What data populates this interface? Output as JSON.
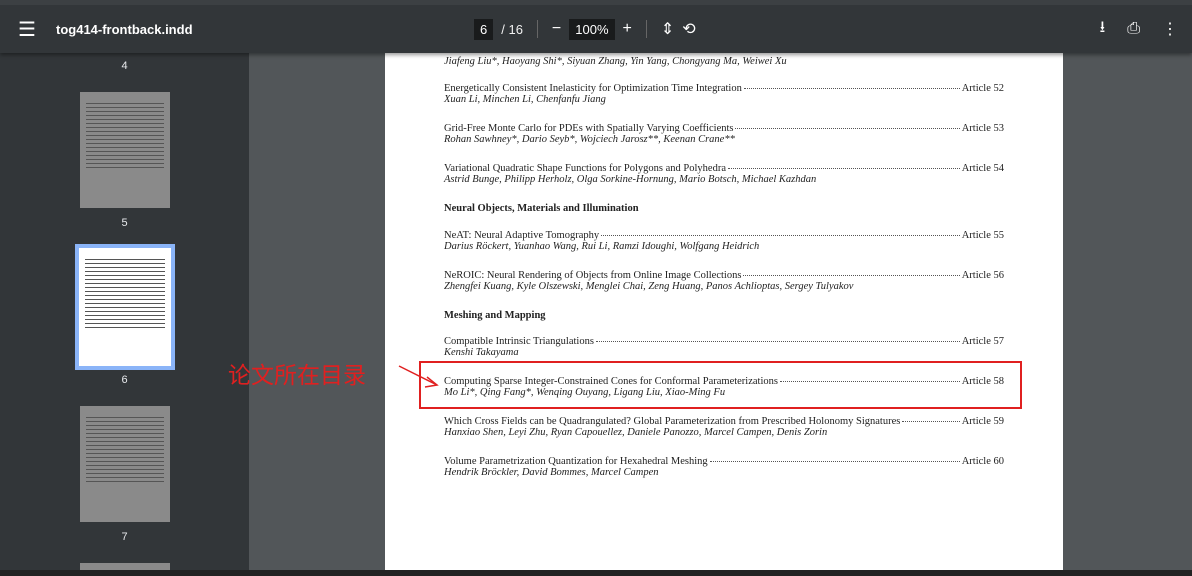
{
  "toolbar": {
    "filename": "tog414-frontback.indd",
    "page_current": "6",
    "page_total": "/ 16",
    "zoom": "100%",
    "menu_icon": "menu-icon",
    "zoom_out": "−",
    "zoom_in": "+",
    "fit_icon": "fit-page-icon",
    "rotate_icon": "rotate-icon",
    "download_icon": "download-icon",
    "print_icon": "print-icon",
    "more_icon": "more-icon"
  },
  "sidebar": {
    "labels": [
      "4",
      "5",
      "6",
      "7"
    ],
    "selected": "6"
  },
  "document": {
    "entries": [
      {
        "title": "",
        "authors": "Jiafeng Liu*, Haoyang Shi*, Siyuan Zhang, Yin Yang, Chongyang Ma, Weiwei Xu",
        "article": ""
      },
      {
        "title": "Energetically Consistent Inelasticity for Optimization Time Integration",
        "authors": "Xuan Li, Minchen Li, Chenfanfu Jiang",
        "article": "Article 52"
      },
      {
        "title": "Grid-Free Monte Carlo for PDEs with Spatially Varying Coefficients",
        "authors": "Rohan Sawhney*, Dario Seyb*, Wojciech Jarosz**, Keenan Crane**",
        "article": "Article 53"
      },
      {
        "title": "Variational Quadratic Shape Functions for Polygons and Polyhedra",
        "authors": "Astrid Bunge, Philipp Herholz, Olga Sorkine-Hornung, Mario Botsch, Michael Kazhdan",
        "article": "Article 54"
      },
      {
        "title": "NeAT: Neural Adaptive Tomography",
        "authors": "Darius Röckert, Yuanhao Wang, Rui Li, Ramzi Idoughi, Wolfgang Heidrich",
        "article": "Article 55"
      },
      {
        "title": "NeROIC: Neural Rendering of Objects from Online Image Collections",
        "authors": "Zhengfei Kuang, Kyle Olszewski, Menglei Chai, Zeng Huang, Panos Achlioptas, Sergey Tulyakov",
        "article": "Article 56"
      },
      {
        "title": "Compatible Intrinsic Triangulations",
        "authors": "Kenshi Takayama",
        "article": "Article 57"
      },
      {
        "title": "Computing Sparse Integer-Constrained Cones for Conformal Parameterizations",
        "authors": "Mo Li*, Qing Fang*, Wenqing Ouyang, Ligang Liu, Xiao-Ming Fu",
        "article": "Article 58"
      },
      {
        "title": "Which Cross Fields can be Quadrangulated? Global Parameterization from Prescribed Holonomy Signatures",
        "authors": "Hanxiao Shen, Leyi Zhu, Ryan Capouellez, Daniele Panozzo, Marcel Campen, Denis Zorin",
        "article": "Article 59"
      },
      {
        "title": "Volume Parametrization Quantization for Hexahedral Meshing",
        "authors": "Hendrik Bröckler, David Bommes, Marcel Campen",
        "article": "Article 60"
      }
    ],
    "sections": [
      "Neural Objects, Materials and Illumination",
      "Meshing and Mapping"
    ]
  },
  "annotation": {
    "text": "论文所在目录",
    "color": "#e02020"
  }
}
